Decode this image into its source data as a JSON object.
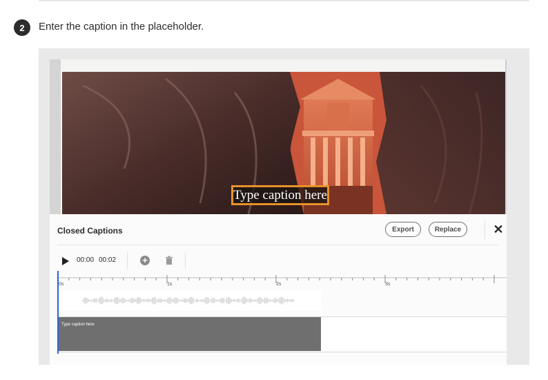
{
  "instructions": {
    "step_number": "2",
    "step_text": "Enter the caption in the placeholder."
  },
  "video": {
    "caption_placeholder": "Type caption here"
  },
  "panel": {
    "title": "Closed Captions",
    "export_label": "Export",
    "replace_label": "Replace",
    "close_icon": "close-icon"
  },
  "player": {
    "current_time": "00:00",
    "duration": "00:02",
    "play_icon": "play-icon",
    "add_icon": "add-circle-icon",
    "delete_icon": "trash-icon"
  },
  "timeline": {
    "ticks": [
      "0s",
      "1s",
      "2s",
      "3s"
    ],
    "clip_text": "Type caption here"
  },
  "colors": {
    "caption_border": "#e8912a",
    "playhead": "#2b63d9",
    "clip": "#6f6f6f"
  }
}
